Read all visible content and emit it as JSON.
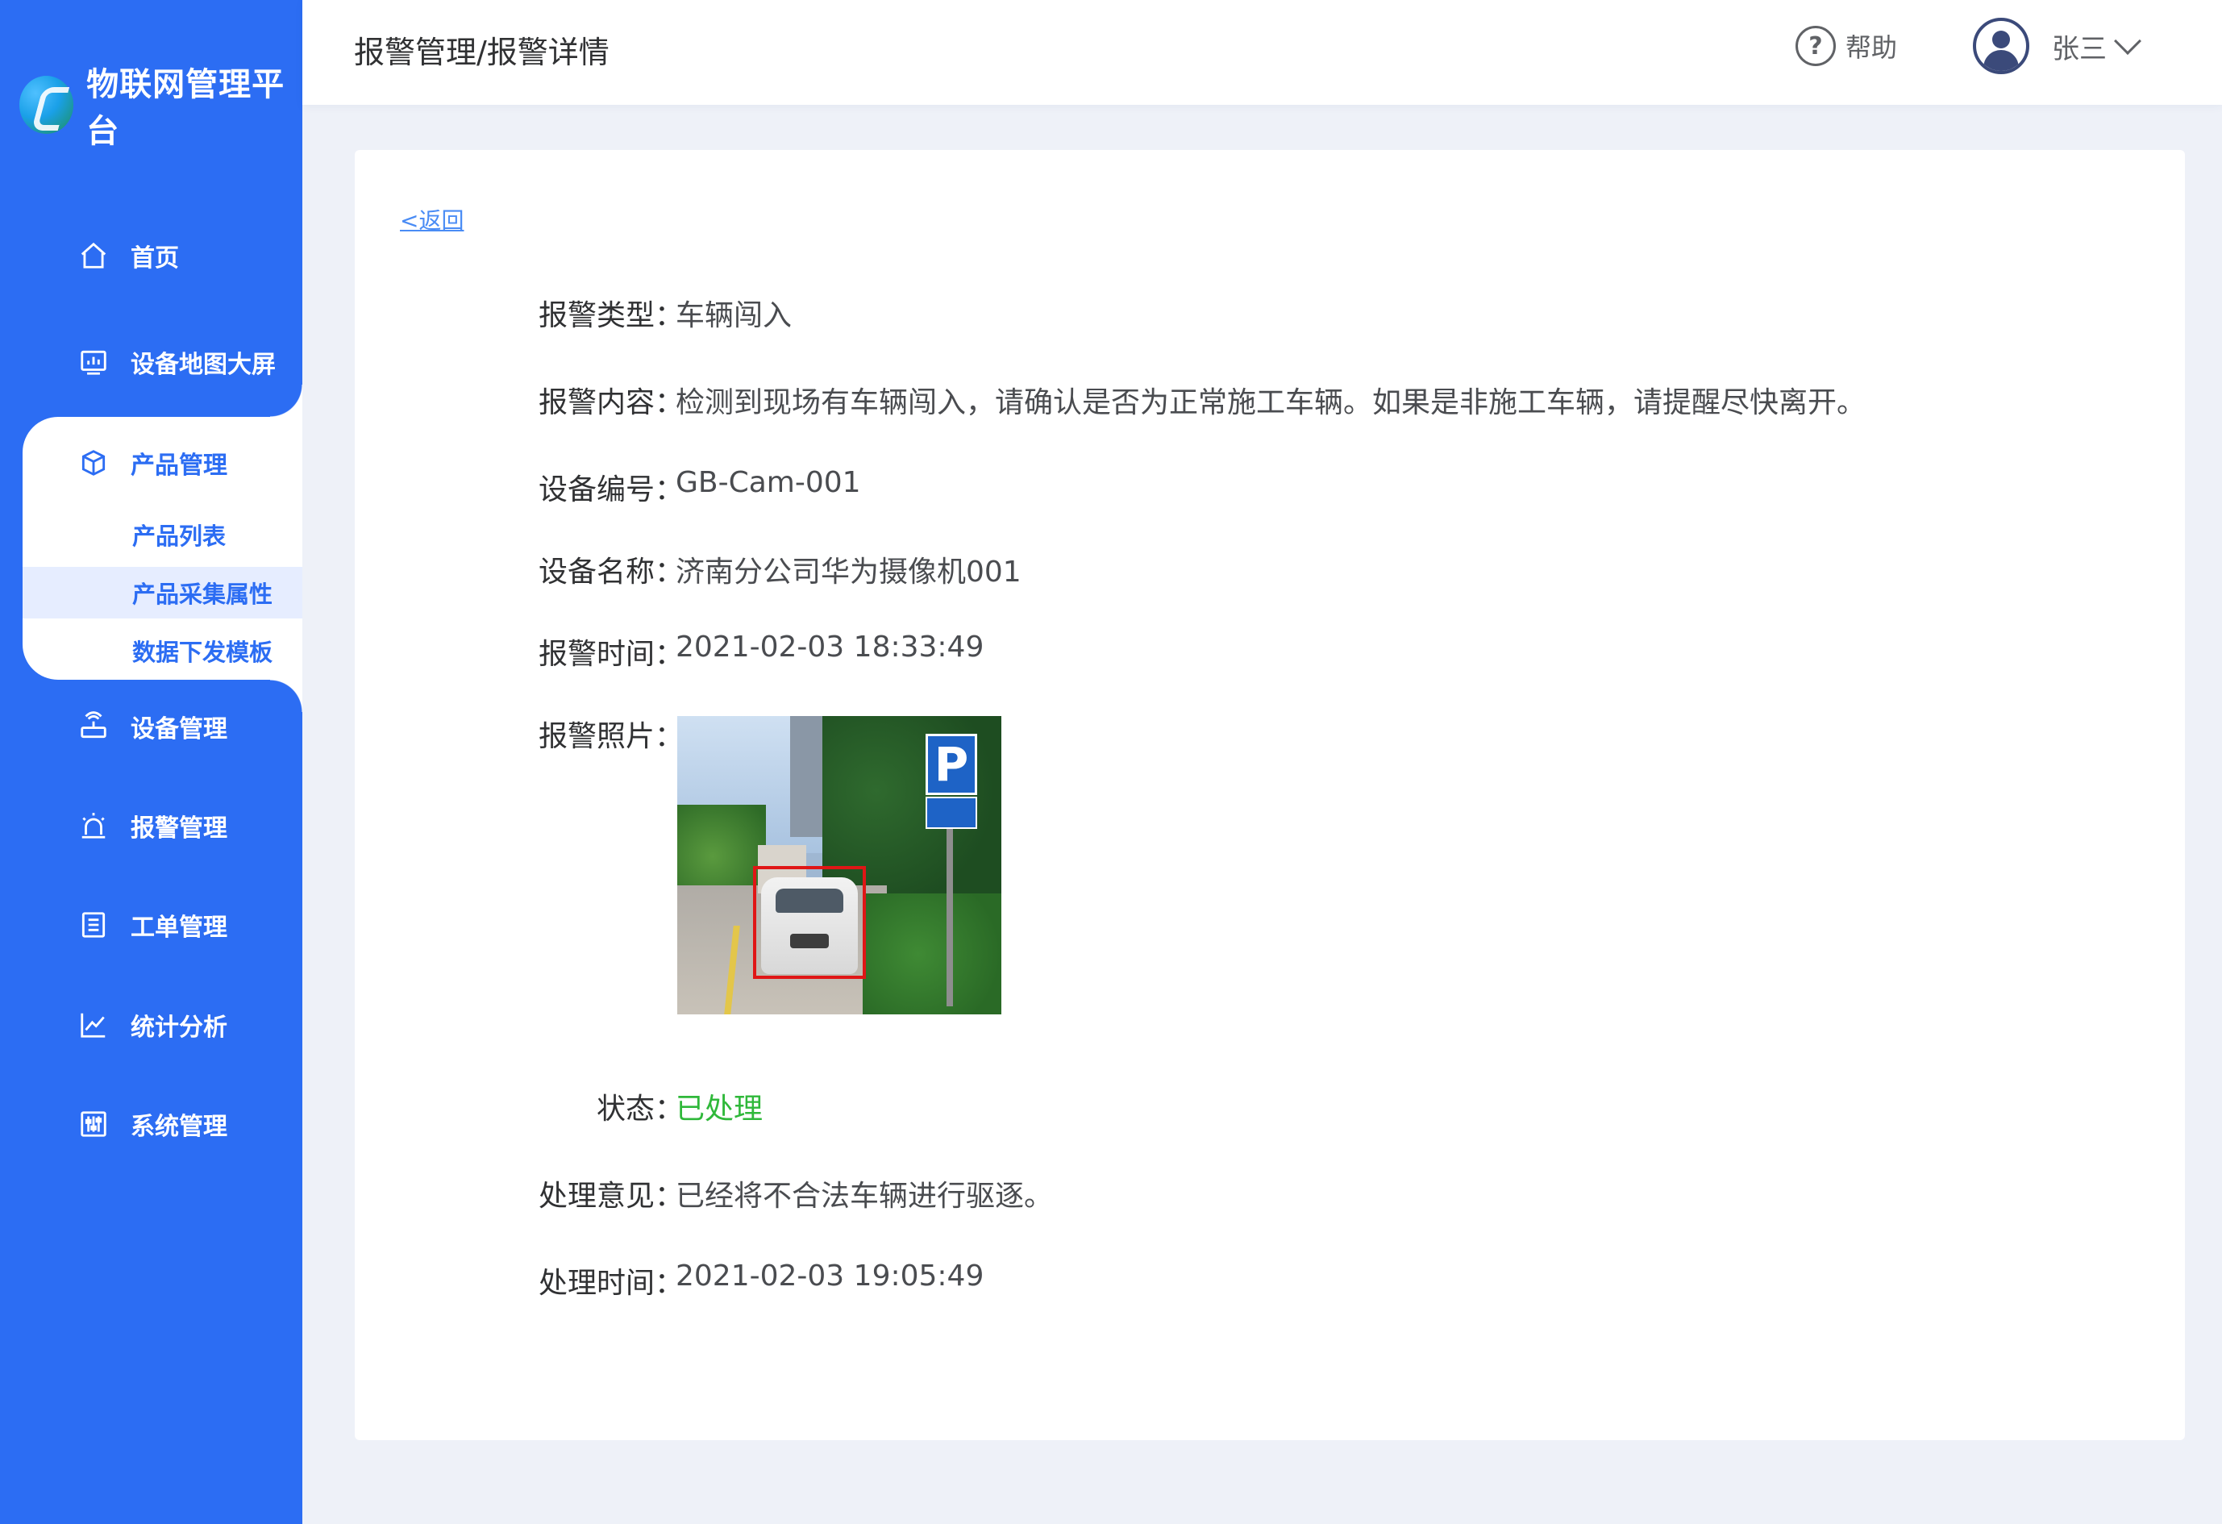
{
  "brand": {
    "name": "物联网管理平台"
  },
  "sidebar": {
    "items": [
      {
        "key": "home",
        "label": "首页",
        "icon": "home-icon"
      },
      {
        "key": "map",
        "label": "设备地图大屏",
        "icon": "dashboard-icon"
      },
      {
        "key": "product",
        "label": "产品管理",
        "icon": "cube-icon",
        "expanded": true,
        "children": [
          {
            "label": "产品列表"
          },
          {
            "label": "产品采集属性",
            "active": true
          },
          {
            "label": "数据下发模板"
          }
        ]
      },
      {
        "key": "device",
        "label": "设备管理",
        "icon": "router-icon"
      },
      {
        "key": "alarm",
        "label": "报警管理",
        "icon": "alarm-icon"
      },
      {
        "key": "workorder",
        "label": "工单管理",
        "icon": "list-icon"
      },
      {
        "key": "stats",
        "label": "统计分析",
        "icon": "line-chart-icon"
      },
      {
        "key": "system",
        "label": "系统管理",
        "icon": "sliders-icon"
      }
    ]
  },
  "header": {
    "breadcrumb": "报警管理/报警详情",
    "help_label": "帮助",
    "help_icon": "help-icon",
    "user_name": "张三"
  },
  "detail": {
    "back_label": "<返回",
    "fields": {
      "type": {
        "label": "报警类型",
        "value": "车辆闯入"
      },
      "content": {
        "label": "报警内容",
        "value": "检测到现场有车辆闯入，请确认是否为正常施工车辆。如果是非施工车辆，请提醒尽快离开。"
      },
      "device_id": {
        "label": "设备编号",
        "value": "GB-Cam-001"
      },
      "device_name": {
        "label": "设备名称",
        "value": "济南分公司华为摄像机001"
      },
      "alarm_time": {
        "label": "报警时间",
        "value": "2021-02-03 18:33:49"
      },
      "photo": {
        "label": "报警照片",
        "sign_text": "P"
      },
      "status": {
        "label": "状态",
        "value": "已处理",
        "color": "#2fb83a"
      },
      "opinion": {
        "label": "处理意见",
        "value": "已经将不合法车辆进行驱逐。"
      },
      "handle_time": {
        "label": "处理时间",
        "value": "2021-02-03 19:05:49"
      }
    },
    "colon": "："
  },
  "colors": {
    "sidebar_bg": "#2c6df3",
    "accent": "#2c6df3",
    "page_bg": "#eef1f8",
    "status_ok": "#2fb83a"
  }
}
